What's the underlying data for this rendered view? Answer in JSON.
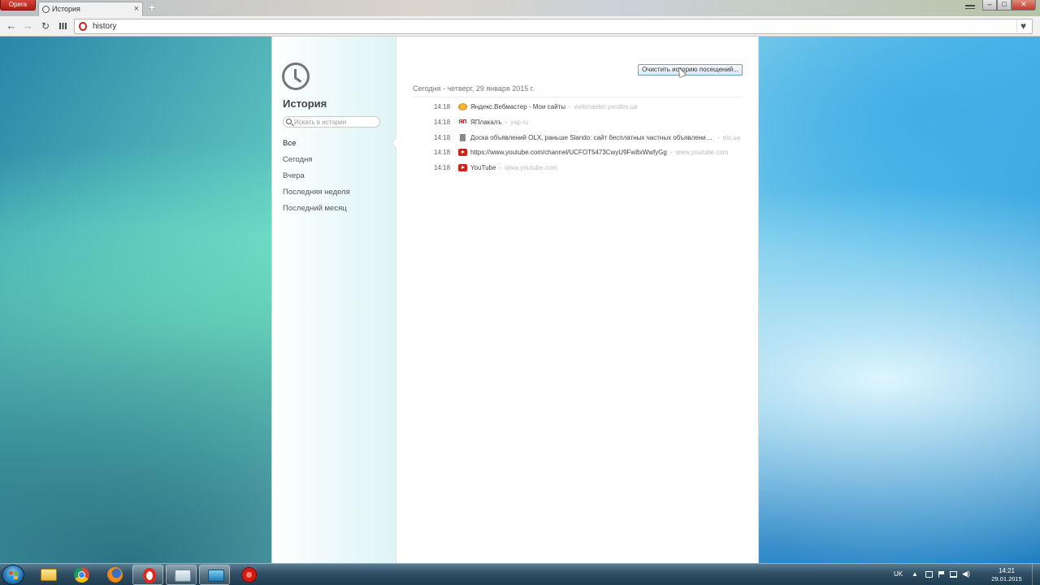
{
  "browser": {
    "menu_label": "Opera",
    "tabs": [
      {
        "label": "История",
        "close": "×"
      }
    ],
    "new_tab_label": "+",
    "window_controls": {
      "minimize": "–",
      "maximize": "□",
      "close": "✕"
    }
  },
  "navbar": {
    "back_glyph": "←",
    "forward_glyph": "→",
    "reload_glyph": "↻",
    "address_value": "history",
    "heart_glyph": "♥"
  },
  "sidebar": {
    "title": "История",
    "search_placeholder": "Искать в истории",
    "filters": [
      {
        "label": "Все",
        "active": true
      },
      {
        "label": "Сегодня"
      },
      {
        "label": "Вчера"
      },
      {
        "label": "Последняя неделя"
      },
      {
        "label": "Последний месяц"
      }
    ]
  },
  "content": {
    "clear_button_label": "Очистить историю посещений...",
    "date_heading": "Сегодня - четверг, 29 января 2015 г.",
    "entries": [
      {
        "time": "14:18",
        "icon": "yandex-icon",
        "title": "Яндекс.Вебмастер - Мои сайты",
        "domain": "webmaster.yandex.ua"
      },
      {
        "time": "14:18",
        "icon": "yap-icon",
        "title": "ЯПлакалъ",
        "domain": "yap.ru"
      },
      {
        "time": "14:18",
        "icon": "document-icon",
        "title": "Доска объявлений OLX, раньше Slando: сайт бесплатных частных объявлений ...",
        "domain": "olx.ua"
      },
      {
        "time": "14:18",
        "icon": "youtube-icon",
        "title": "https://www.youtube.com/channel/UCFOT5473CwyU9Fw8xWwfyGg",
        "domain": "www.youtube.com"
      },
      {
        "time": "14:18",
        "icon": "youtube-icon",
        "title": "YouTube",
        "domain": "www.youtube.com"
      }
    ],
    "separator": "-"
  },
  "taskbar": {
    "apps": [
      "explorer-icon",
      "chrome-icon",
      "firefox-icon",
      "opera-icon",
      "files-icon",
      "media-icon",
      "recorder-icon"
    ],
    "tray": {
      "language": "UK",
      "arrow": "▲",
      "volume_glyph": "◀)",
      "time": "14:21",
      "date": "29.01.2015"
    }
  }
}
